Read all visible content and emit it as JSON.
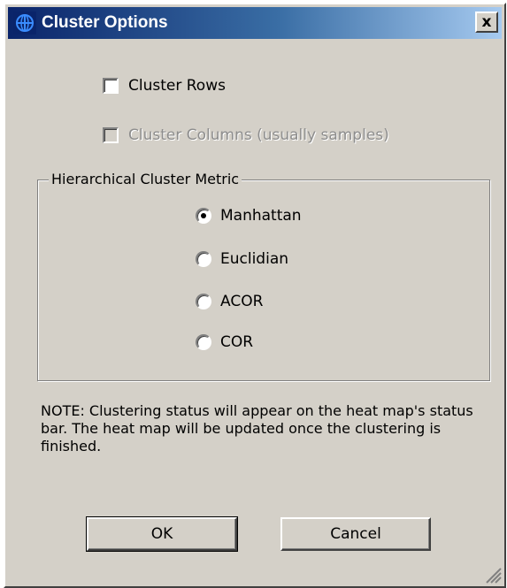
{
  "window": {
    "title": "Cluster Options",
    "close_label": "x"
  },
  "options": {
    "cluster_rows": {
      "label": "Cluster Rows",
      "checked": false,
      "enabled": true
    },
    "cluster_columns": {
      "label": "Cluster Columns (usually samples)",
      "checked": false,
      "enabled": false
    }
  },
  "metric_group": {
    "label": "Hierarchical Cluster Metric",
    "selected": "Manhattan",
    "options": [
      "Manhattan",
      "Euclidian",
      "ACOR",
      "COR"
    ]
  },
  "note": "NOTE: Clustering status will appear on the heat map's status bar. The heat map will be updated once the clustering is finished.",
  "buttons": {
    "ok_label": "OK",
    "cancel_label": "Cancel"
  },
  "colors": {
    "titlebar_start": "#0a246a",
    "titlebar_end": "#a6caf0",
    "face": "#d4d0c8"
  },
  "icons": {
    "title": "cluster-app-icon",
    "close": "close-icon",
    "resize": "resize-grip-icon"
  }
}
